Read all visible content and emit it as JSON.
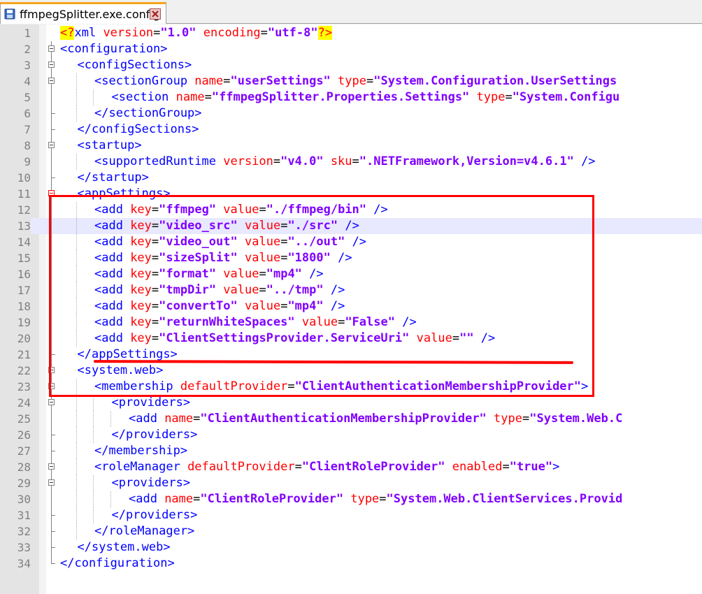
{
  "tab": {
    "label": "ffmpegSplitter.exe.config",
    "icon": "save-icon",
    "close_icon": "close-icon"
  },
  "colors": {
    "tag": "#0000ff",
    "attr": "#ff0000",
    "value": "#8000ff",
    "annotation": "#ff0000",
    "current_line": "#e8e8ff"
  },
  "lines": [
    {
      "n": "1",
      "fold": "none",
      "indent": 0,
      "tokens": [
        [
          "pi",
          "<?"
        ],
        [
          "tag",
          "xml "
        ],
        [
          "attr",
          "version"
        ],
        [
          "eq",
          "="
        ],
        [
          "val",
          "\"1.0\""
        ],
        [
          "tag",
          " "
        ],
        [
          "attr",
          "encoding"
        ],
        [
          "eq",
          "="
        ],
        [
          "val",
          "\"utf-8\""
        ],
        [
          "pi",
          "?>"
        ]
      ]
    },
    {
      "n": "2",
      "fold": "open",
      "indent": 0,
      "tokens": [
        [
          "tag",
          "<configuration>"
        ]
      ]
    },
    {
      "n": "3",
      "fold": "open",
      "indent": 1,
      "tokens": [
        [
          "tag",
          "<configSections>"
        ]
      ]
    },
    {
      "n": "4",
      "fold": "open",
      "indent": 2,
      "tokens": [
        [
          "tag",
          "<sectionGroup "
        ],
        [
          "attr",
          "name"
        ],
        [
          "eq",
          "="
        ],
        [
          "val",
          "\"userSettings\""
        ],
        [
          "tag",
          " "
        ],
        [
          "attr",
          "type"
        ],
        [
          "eq",
          "="
        ],
        [
          "val",
          "\"System.Configuration.UserSettings"
        ]
      ]
    },
    {
      "n": "5",
      "fold": "line",
      "indent": 3,
      "tokens": [
        [
          "tag",
          "<section "
        ],
        [
          "attr",
          "name"
        ],
        [
          "eq",
          "="
        ],
        [
          "val",
          "\"ffmpegSplitter.Properties.Settings\""
        ],
        [
          "tag",
          " "
        ],
        [
          "attr",
          "type"
        ],
        [
          "eq",
          "="
        ],
        [
          "val",
          "\"System.Configu"
        ]
      ]
    },
    {
      "n": "6",
      "fold": "end",
      "indent": 2,
      "tokens": [
        [
          "tag",
          "</sectionGroup>"
        ]
      ]
    },
    {
      "n": "7",
      "fold": "end",
      "indent": 1,
      "tokens": [
        [
          "tag",
          "</configSections>"
        ]
      ]
    },
    {
      "n": "8",
      "fold": "open",
      "indent": 1,
      "tokens": [
        [
          "tag",
          "<startup>"
        ]
      ]
    },
    {
      "n": "9",
      "fold": "line",
      "indent": 2,
      "tokens": [
        [
          "tag",
          "<supportedRuntime "
        ],
        [
          "attr",
          "version"
        ],
        [
          "eq",
          "="
        ],
        [
          "val",
          "\"v4.0\""
        ],
        [
          "tag",
          " "
        ],
        [
          "attr",
          "sku"
        ],
        [
          "eq",
          "="
        ],
        [
          "val",
          "\".NETFramework,Version=v4.6.1\""
        ],
        [
          "tag",
          " />"
        ]
      ]
    },
    {
      "n": "10",
      "fold": "end",
      "indent": 1,
      "tokens": [
        [
          "tag",
          "</startup>"
        ]
      ]
    },
    {
      "n": "11",
      "fold": "open-red",
      "indent": 1,
      "tokens": [
        [
          "tag",
          "<appSettings>"
        ]
      ]
    },
    {
      "n": "12",
      "fold": "line",
      "indent": 2,
      "tokens": [
        [
          "tag",
          "<add "
        ],
        [
          "attr",
          "key"
        ],
        [
          "eq",
          "="
        ],
        [
          "val",
          "\"ffmpeg\""
        ],
        [
          "tag",
          " "
        ],
        [
          "attr",
          "value"
        ],
        [
          "eq",
          "="
        ],
        [
          "val",
          "\"./ffmpeg/bin\""
        ],
        [
          "tag",
          " />"
        ]
      ]
    },
    {
      "n": "13",
      "fold": "line",
      "indent": 2,
      "cur": true,
      "tokens": [
        [
          "tag",
          "<add "
        ],
        [
          "attr",
          "key"
        ],
        [
          "eq",
          "="
        ],
        [
          "val",
          "\"video_src\""
        ],
        [
          "tag",
          " "
        ],
        [
          "attr",
          "value"
        ],
        [
          "eq",
          "="
        ],
        [
          "val",
          "\"./src\""
        ],
        [
          "tag",
          " />"
        ]
      ]
    },
    {
      "n": "14",
      "fold": "line",
      "indent": 2,
      "tokens": [
        [
          "tag",
          "<add "
        ],
        [
          "attr",
          "key"
        ],
        [
          "eq",
          "="
        ],
        [
          "val",
          "\"video_out\""
        ],
        [
          "tag",
          " "
        ],
        [
          "attr",
          "value"
        ],
        [
          "eq",
          "="
        ],
        [
          "val",
          "\"../out\""
        ],
        [
          "tag",
          " />"
        ]
      ]
    },
    {
      "n": "15",
      "fold": "line",
      "indent": 2,
      "tokens": [
        [
          "tag",
          "<add "
        ],
        [
          "attr",
          "key"
        ],
        [
          "eq",
          "="
        ],
        [
          "val",
          "\"sizeSplit\""
        ],
        [
          "tag",
          " "
        ],
        [
          "attr",
          "value"
        ],
        [
          "eq",
          "="
        ],
        [
          "val",
          "\"1800\""
        ],
        [
          "tag",
          " />"
        ]
      ]
    },
    {
      "n": "16",
      "fold": "line",
      "indent": 2,
      "tokens": [
        [
          "tag",
          "<add "
        ],
        [
          "attr",
          "key"
        ],
        [
          "eq",
          "="
        ],
        [
          "val",
          "\"format\""
        ],
        [
          "tag",
          " "
        ],
        [
          "attr",
          "value"
        ],
        [
          "eq",
          "="
        ],
        [
          "val",
          "\"mp4\""
        ],
        [
          "tag",
          " />"
        ]
      ]
    },
    {
      "n": "17",
      "fold": "line",
      "indent": 2,
      "tokens": [
        [
          "tag",
          "<add "
        ],
        [
          "attr",
          "key"
        ],
        [
          "eq",
          "="
        ],
        [
          "val",
          "\"tmpDir\""
        ],
        [
          "tag",
          " "
        ],
        [
          "attr",
          "value"
        ],
        [
          "eq",
          "="
        ],
        [
          "val",
          "\"../tmp\""
        ],
        [
          "tag",
          " />"
        ]
      ]
    },
    {
      "n": "18",
      "fold": "line",
      "indent": 2,
      "tokens": [
        [
          "tag",
          "<add "
        ],
        [
          "attr",
          "key"
        ],
        [
          "eq",
          "="
        ],
        [
          "val",
          "\"convertTo\""
        ],
        [
          "tag",
          " "
        ],
        [
          "attr",
          "value"
        ],
        [
          "eq",
          "="
        ],
        [
          "val",
          "\"mp4\""
        ],
        [
          "tag",
          " />"
        ]
      ]
    },
    {
      "n": "19",
      "fold": "line",
      "indent": 2,
      "tokens": [
        [
          "tag",
          "<add "
        ],
        [
          "attr",
          "key"
        ],
        [
          "eq",
          "="
        ],
        [
          "val",
          "\"returnWhiteSpaces\""
        ],
        [
          "tag",
          " "
        ],
        [
          "attr",
          "value"
        ],
        [
          "eq",
          "="
        ],
        [
          "val",
          "\"False\""
        ],
        [
          "tag",
          " />"
        ]
      ]
    },
    {
      "n": "20",
      "fold": "line",
      "indent": 2,
      "tokens": [
        [
          "tag",
          "<add "
        ],
        [
          "attr",
          "key"
        ],
        [
          "eq",
          "="
        ],
        [
          "val",
          "\"ClientSettingsProvider.ServiceUri\""
        ],
        [
          "tag",
          " "
        ],
        [
          "attr",
          "value"
        ],
        [
          "eq",
          "="
        ],
        [
          "val",
          "\"\""
        ],
        [
          "tag",
          " />"
        ]
      ]
    },
    {
      "n": "21",
      "fold": "end",
      "indent": 1,
      "tokens": [
        [
          "tag",
          "</appSettings>"
        ]
      ]
    },
    {
      "n": "22",
      "fold": "open",
      "indent": 1,
      "tokens": [
        [
          "tag",
          "<system.web>"
        ]
      ]
    },
    {
      "n": "23",
      "fold": "open",
      "indent": 2,
      "tokens": [
        [
          "tag",
          "<membership "
        ],
        [
          "attr",
          "defaultProvider"
        ],
        [
          "eq",
          "="
        ],
        [
          "val",
          "\"ClientAuthenticationMembershipProvider\""
        ],
        [
          "tag",
          ">"
        ]
      ]
    },
    {
      "n": "24",
      "fold": "open",
      "indent": 3,
      "tokens": [
        [
          "tag",
          "<providers>"
        ]
      ]
    },
    {
      "n": "25",
      "fold": "line",
      "indent": 4,
      "tokens": [
        [
          "tag",
          "<add "
        ],
        [
          "attr",
          "name"
        ],
        [
          "eq",
          "="
        ],
        [
          "val",
          "\"ClientAuthenticationMembershipProvider\""
        ],
        [
          "tag",
          " "
        ],
        [
          "attr",
          "type"
        ],
        [
          "eq",
          "="
        ],
        [
          "val",
          "\"System.Web.C"
        ]
      ]
    },
    {
      "n": "26",
      "fold": "end",
      "indent": 3,
      "tokens": [
        [
          "tag",
          "</providers>"
        ]
      ]
    },
    {
      "n": "27",
      "fold": "end",
      "indent": 2,
      "tokens": [
        [
          "tag",
          "</membership>"
        ]
      ]
    },
    {
      "n": "28",
      "fold": "open",
      "indent": 2,
      "tokens": [
        [
          "tag",
          "<roleManager "
        ],
        [
          "attr",
          "defaultProvider"
        ],
        [
          "eq",
          "="
        ],
        [
          "val",
          "\"ClientRoleProvider\""
        ],
        [
          "tag",
          " "
        ],
        [
          "attr",
          "enabled"
        ],
        [
          "eq",
          "="
        ],
        [
          "val",
          "\"true\""
        ],
        [
          "tag",
          ">"
        ]
      ]
    },
    {
      "n": "29",
      "fold": "open",
      "indent": 3,
      "tokens": [
        [
          "tag",
          "<providers>"
        ]
      ]
    },
    {
      "n": "30",
      "fold": "line",
      "indent": 4,
      "tokens": [
        [
          "tag",
          "<add "
        ],
        [
          "attr",
          "name"
        ],
        [
          "eq",
          "="
        ],
        [
          "val",
          "\"ClientRoleProvider\""
        ],
        [
          "tag",
          " "
        ],
        [
          "attr",
          "type"
        ],
        [
          "eq",
          "="
        ],
        [
          "val",
          "\"System.Web.ClientServices.Provid"
        ]
      ]
    },
    {
      "n": "31",
      "fold": "end",
      "indent": 3,
      "tokens": [
        [
          "tag",
          "</providers>"
        ]
      ]
    },
    {
      "n": "32",
      "fold": "end",
      "indent": 2,
      "tokens": [
        [
          "tag",
          "</roleManager>"
        ]
      ]
    },
    {
      "n": "33",
      "fold": "end",
      "indent": 1,
      "tokens": [
        [
          "tag",
          "</system.web>"
        ]
      ]
    },
    {
      "n": "34",
      "fold": "last",
      "indent": 0,
      "tokens": [
        [
          "tag",
          "</configuration>"
        ]
      ]
    }
  ]
}
